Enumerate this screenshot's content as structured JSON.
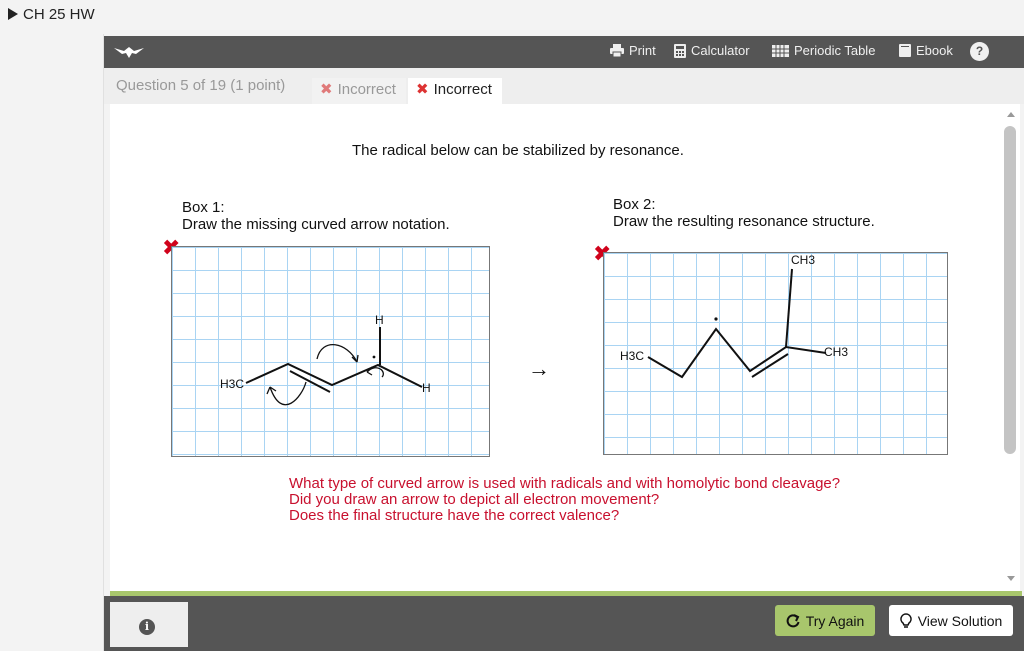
{
  "breadcrumb": {
    "title": "CH 25 HW"
  },
  "toolbar": {
    "print": "Print",
    "calculator": "Calculator",
    "periodic_table": "Periodic Table",
    "ebook": "Ebook",
    "help": "?"
  },
  "question": {
    "label": "Question 5 of 19 (1 point)",
    "attempts": [
      {
        "label": "Incorrect",
        "active": false
      },
      {
        "label": "Incorrect",
        "active": true
      }
    ]
  },
  "content": {
    "intro": "The radical below can be stabilized by resonance.",
    "box1": {
      "title": "Box 1:",
      "instruction": "Draw the missing curved arrow notation."
    },
    "box2": {
      "title": "Box 2:",
      "instruction": "Draw the resulting resonance structure."
    },
    "structure1": {
      "h3c": "H3C",
      "h_top": "H",
      "h_right": "H"
    },
    "structure2": {
      "h3c": "H3C",
      "ch3_top": "CH3",
      "ch3_right": "CH3"
    },
    "reaction_arrow": "→",
    "hints": [
      "What type of curved arrow is used with radicals and with homolytic bond cleavage?",
      "Did you draw an arrow to depict all electron movement?",
      "Does the final structure have the correct valence?"
    ]
  },
  "footer": {
    "try_again": "Try Again",
    "view_solution": "View Solution"
  },
  "colors": {
    "toolbar_bg": "#555555",
    "incorrect_red": "#d0021b",
    "hint_red": "#c8102e",
    "try_again_green": "#a8c66c",
    "grid_line": "#a9d4f3"
  }
}
